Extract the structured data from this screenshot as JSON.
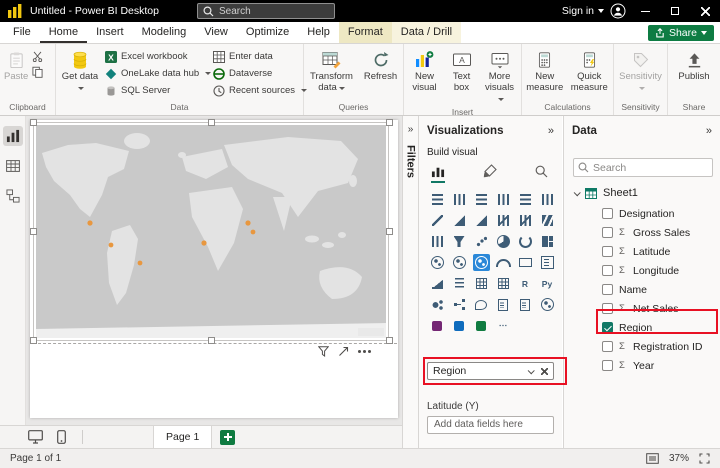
{
  "titlebar": {
    "app_title": "Untitled - Power BI Desktop",
    "search_placeholder": "Search",
    "sign_in_label": "Sign in"
  },
  "menubar": {
    "tabs": [
      {
        "name": "tab-file",
        "label": "File",
        "cls": ""
      },
      {
        "name": "tab-home",
        "label": "Home",
        "cls": "active"
      },
      {
        "name": "tab-insert",
        "label": "Insert",
        "cls": ""
      },
      {
        "name": "tab-modeling",
        "label": "Modeling",
        "cls": ""
      },
      {
        "name": "tab-view",
        "label": "View",
        "cls": ""
      },
      {
        "name": "tab-optimize",
        "label": "Optimize",
        "cls": ""
      },
      {
        "name": "tab-help",
        "label": "Help",
        "cls": ""
      },
      {
        "name": "tab-format",
        "label": "Format",
        "cls": "ctx active-ctx"
      },
      {
        "name": "tab-data-drill",
        "label": "Data / Drill",
        "cls": "ctx"
      }
    ],
    "share_label": "Share"
  },
  "ribbon": {
    "clipboard": {
      "label": "Clipboard",
      "paste": "Paste"
    },
    "data": {
      "label": "Data",
      "get_data": "Get data",
      "excel_workbook": "Excel workbook",
      "onelake": "OneLake data hub",
      "sql_server": "SQL Server",
      "enter_data": "Enter data",
      "dataverse": "Dataverse",
      "recent_sources": "Recent sources"
    },
    "queries": {
      "label": "Queries",
      "transform_data": "Transform data",
      "refresh": "Refresh"
    },
    "insert": {
      "label": "Insert",
      "new_visual": "New visual",
      "text_box": "Text box",
      "more_visuals": "More visuals"
    },
    "calculations": {
      "label": "Calculations",
      "new_measure": "New measure",
      "quick_measure": "Quick measure"
    },
    "sensitivity": {
      "label": "Sensitivity",
      "sensitivity": "Sensitivity"
    },
    "share": {
      "label": "Share",
      "publish": "Publish"
    }
  },
  "filters_panel": {
    "title": "Filters"
  },
  "visualizations_panel": {
    "title": "Visualizations",
    "build_label": "Build visual",
    "wells": {
      "location_field": "Region",
      "latitude_label": "Latitude (Y)",
      "dropzone_placeholder": "Add data fields here"
    },
    "visual_types": [
      {
        "name": "visual-type-stacked-bar-chart",
        "cls": "hbar",
        "glyph": ""
      },
      {
        "name": "visual-type-stacked-column-chart",
        "cls": "vbar",
        "glyph": ""
      },
      {
        "name": "visual-type-clustered-bar-chart",
        "cls": "hbar",
        "glyph": ""
      },
      {
        "name": "visual-type-clustered-column-chart",
        "cls": "vbar",
        "glyph": ""
      },
      {
        "name": "visual-type-100-stacked-bar-chart",
        "cls": "hbar",
        "glyph": ""
      },
      {
        "name": "visual-type-100-stacked-column-chart",
        "cls": "vbar",
        "glyph": ""
      },
      {
        "name": "visual-type-line-chart",
        "cls": "line",
        "glyph": ""
      },
      {
        "name": "visual-type-area-chart",
        "cls": "area",
        "glyph": ""
      },
      {
        "name": "visual-type-stacked-area-chart",
        "cls": "area",
        "glyph": ""
      },
      {
        "name": "visual-type-line-and-stacked-column-chart",
        "cls": "combo",
        "glyph": ""
      },
      {
        "name": "visual-type-line-and-clustered-column-chart",
        "cls": "combo",
        "glyph": ""
      },
      {
        "name": "visual-type-ribbon-chart",
        "cls": "ribbon",
        "glyph": ""
      },
      {
        "name": "visual-type-waterfall-chart",
        "cls": "vbar",
        "glyph": ""
      },
      {
        "name": "visual-type-funnel-chart",
        "cls": "funnel",
        "glyph": ""
      },
      {
        "name": "visual-type-scatter-chart",
        "cls": "scatter",
        "glyph": ""
      },
      {
        "name": "visual-type-pie-chart",
        "cls": "pie",
        "glyph": ""
      },
      {
        "name": "visual-type-donut-chart",
        "cls": "donut",
        "glyph": ""
      },
      {
        "name": "visual-type-treemap",
        "cls": "treemap",
        "glyph": ""
      },
      {
        "name": "visual-type-map",
        "cls": "map",
        "glyph": ""
      },
      {
        "name": "visual-type-filled-map",
        "cls": "map",
        "glyph": ""
      },
      {
        "name": "visual-type-azure-map",
        "cls": "map selected",
        "glyph": ""
      },
      {
        "name": "visual-type-gauge",
        "cls": "gauge",
        "glyph": ""
      },
      {
        "name": "visual-type-card",
        "cls": "card",
        "glyph": ""
      },
      {
        "name": "visual-type-multi-row-card",
        "cls": "mcard",
        "glyph": ""
      },
      {
        "name": "visual-type-kpi",
        "cls": "kpi",
        "glyph": ""
      },
      {
        "name": "visual-type-slicer",
        "cls": "slicer",
        "glyph": ""
      },
      {
        "name": "visual-type-table",
        "cls": "grid",
        "glyph": ""
      },
      {
        "name": "visual-type-matrix",
        "cls": "grid",
        "glyph": ""
      },
      {
        "name": "visual-type-r-script",
        "cls": "txt",
        "glyph": "R"
      },
      {
        "name": "visual-type-python",
        "cls": "txt",
        "glyph": "Py"
      },
      {
        "name": "visual-type-key-influencers",
        "cls": "influencer",
        "glyph": ""
      },
      {
        "name": "visual-type-decomposition-tree",
        "cls": "tree",
        "glyph": ""
      },
      {
        "name": "visual-type-qa",
        "cls": "bubble",
        "glyph": ""
      },
      {
        "name": "visual-type-smart-narrative",
        "cls": "doc",
        "glyph": ""
      },
      {
        "name": "visual-type-paginated-report",
        "cls": "doc",
        "glyph": ""
      },
      {
        "name": "visual-type-arcgis-map",
        "cls": "map",
        "glyph": ""
      },
      {
        "name": "visual-type-power-apps",
        "cls": "colored-purple",
        "glyph": ""
      },
      {
        "name": "visual-type-power-automate",
        "cls": "colored-blue",
        "glyph": ""
      },
      {
        "name": "visual-type-metrics",
        "cls": "colored-green",
        "glyph": ""
      },
      {
        "name": "visual-type-more",
        "cls": "txt",
        "glyph": "⋯"
      }
    ]
  },
  "data_panel": {
    "title": "Data",
    "search_placeholder": "Search",
    "table_name": "Sheet1",
    "fields": [
      {
        "name": "field-row-designation",
        "label": "Designation",
        "sigma": "",
        "checkbox_cls": ""
      },
      {
        "name": "field-row-gross-sales",
        "label": "Gross Sales",
        "sigma": "Σ",
        "checkbox_cls": ""
      },
      {
        "name": "field-row-latitude",
        "label": "Latitude",
        "sigma": "Σ",
        "checkbox_cls": ""
      },
      {
        "name": "field-row-longitude",
        "label": "Longitude",
        "sigma": "Σ",
        "checkbox_cls": ""
      },
      {
        "name": "field-row-name",
        "label": "Name",
        "sigma": "",
        "checkbox_cls": ""
      },
      {
        "name": "field-row-net-sales",
        "label": "Net Sales",
        "sigma": "Σ",
        "checkbox_cls": ""
      },
      {
        "name": "field-row-region",
        "label": "Region",
        "sigma": "",
        "checkbox_cls": "checked"
      },
      {
        "name": "field-row-registration-id",
        "label": "Registration ID",
        "sigma": "Σ",
        "checkbox_cls": ""
      },
      {
        "name": "field-row-year",
        "label": "Year",
        "sigma": "Σ",
        "checkbox_cls": ""
      }
    ]
  },
  "pagebar": {
    "page_tab": "Page 1"
  },
  "statusbar": {
    "page_indicator": "Page 1 of 1",
    "zoom": "37%"
  },
  "icons": {
    "collapse": "»"
  },
  "colors": {
    "annotation_red": "#E81123",
    "share_green": "#0E7C43",
    "selected_visual_blue": "#2B88D8",
    "accent_teal": "#117865",
    "get_data_yellow": "#F2C811",
    "map_bubble_orange": "#E8973F"
  }
}
